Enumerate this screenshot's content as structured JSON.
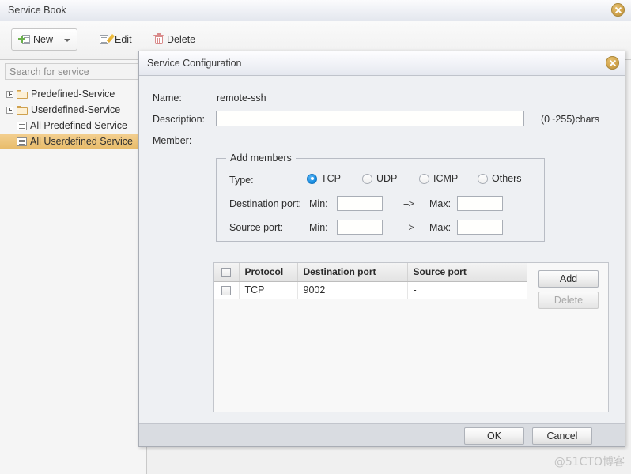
{
  "window": {
    "title": "Service Book",
    "close_icon": "close-icon"
  },
  "toolbar": {
    "new_label": "New",
    "edit_label": "Edit",
    "delete_label": "Delete"
  },
  "sidebar": {
    "search": {
      "placeholder": "Search for service",
      "value": ""
    },
    "items": [
      {
        "label": "Predefined-Service",
        "icon": "folder-icon",
        "expandable": true,
        "selected": false
      },
      {
        "label": "Userdefined-Service",
        "icon": "folder-icon",
        "expandable": true,
        "selected": false
      },
      {
        "label": "All Predefined Service",
        "icon": "list-icon",
        "expandable": false,
        "selected": false
      },
      {
        "label": "All Userdefined Service",
        "icon": "list-icon",
        "expandable": false,
        "selected": true
      }
    ]
  },
  "dialog": {
    "title": "Service Configuration",
    "close_icon": "close-icon",
    "name_label": "Name:",
    "name_value": "remote-ssh",
    "description_label": "Description:",
    "description_value": "",
    "description_hint": "(0~255)chars",
    "member_label": "Member:",
    "group": {
      "legend": "Add members",
      "type_label": "Type:",
      "type_options": [
        {
          "label": "TCP",
          "checked": true
        },
        {
          "label": "UDP",
          "checked": false
        },
        {
          "label": "ICMP",
          "checked": false
        },
        {
          "label": "Others",
          "checked": false
        }
      ],
      "destination_port_label": "Destination port:",
      "source_port_label": "Source port:",
      "min_label": "Min:",
      "max_label": "Max:",
      "arrow": "-->",
      "dest_min_value": "",
      "dest_max_value": "",
      "src_min_value": "",
      "src_max_value": ""
    },
    "table": {
      "columns": [
        "Protocol",
        "Destination port",
        "Source port"
      ],
      "rows": [
        {
          "protocol": "TCP",
          "destination_port": "9002",
          "source_port": "-",
          "checked": false
        }
      ],
      "add_label": "Add",
      "delete_label": "Delete"
    },
    "ok_label": "OK",
    "cancel_label": "Cancel"
  },
  "watermark": "@51CTO博客",
  "colors": {
    "accent_blue": "#1a8fe3",
    "selection_orange": "#e8bc6b",
    "close_button": "#cfa149"
  }
}
